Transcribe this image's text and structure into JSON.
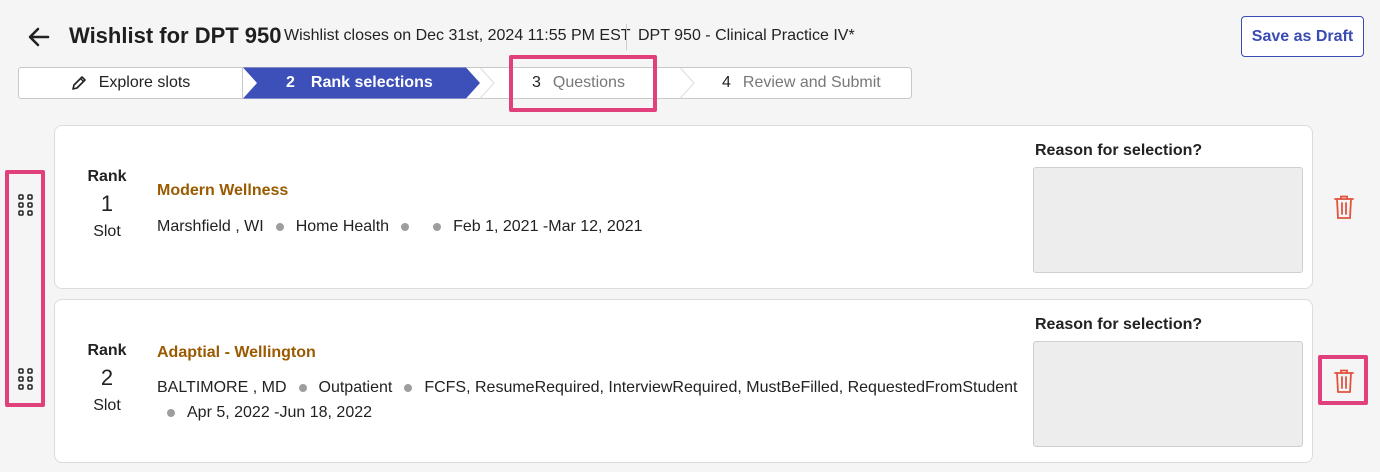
{
  "header": {
    "title": "Wishlist for DPT 950",
    "closes_text": "Wishlist closes on Dec 31st, 2024 11:55 PM EST",
    "course_text": "DPT 950 - Clinical Practice IV*",
    "save_draft_label": "Save as Draft"
  },
  "stepper": {
    "steps": [
      {
        "num": "",
        "label": "Explore slots",
        "state": "done"
      },
      {
        "num": "2",
        "label": "Rank selections",
        "state": "active"
      },
      {
        "num": "3",
        "label": "Questions",
        "state": "upcoming"
      },
      {
        "num": "4",
        "label": "Review and Submit",
        "state": "upcoming"
      }
    ]
  },
  "colors": {
    "accent": "#3a4bb3",
    "location_name": "#9a5a00",
    "delete": "#e0533d",
    "highlight": "#e0407b"
  },
  "selections": [
    {
      "rank_label": "Rank",
      "rank_num": "1",
      "slot_label": "Slot",
      "name": "Modern Wellness",
      "city": "Marshfield , WI",
      "type": "Home Health",
      "tags": "",
      "dates": "Feb 1, 2021 -Mar 12, 2021",
      "reason_label": "Reason for selection?",
      "reason_value": ""
    },
    {
      "rank_label": "Rank",
      "rank_num": "2",
      "slot_label": "Slot",
      "name": "Adaptial - Wellington",
      "city": "BALTIMORE , MD",
      "type": "Outpatient",
      "tags": "FCFS, ResumeRequired, InterviewRequired, MustBeFilled, RequestedFromStudent",
      "dates": "Apr 5, 2022 -Jun 18, 2022",
      "reason_label": "Reason for selection?",
      "reason_value": ""
    }
  ]
}
